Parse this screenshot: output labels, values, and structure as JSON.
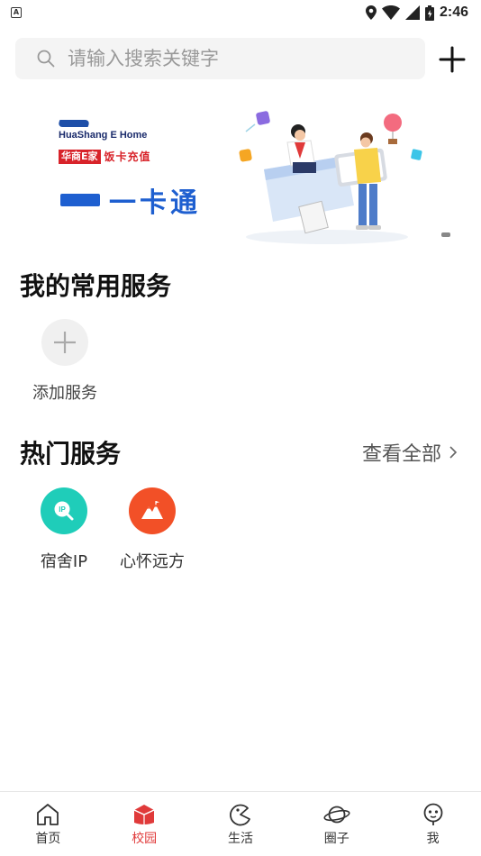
{
  "status_bar": {
    "time": "2:46",
    "notification_glyph": "A"
  },
  "search": {
    "placeholder": "请输入搜索关键字"
  },
  "banner": {
    "brand_en": "HuaShang E Home",
    "brand_tag": "华商E家",
    "tag_text": "饭卡充值",
    "title": "一卡通"
  },
  "favorites": {
    "title": "我的常用服务",
    "add_label": "添加服务"
  },
  "hot": {
    "title": "热门服务",
    "view_all": "查看全部",
    "items": [
      {
        "label": "宿舍IP",
        "color": "#1fcdb9",
        "icon": "ip-search-icon",
        "icon_text": "IP"
      },
      {
        "label": "心怀远方",
        "color": "#f25027",
        "icon": "mountain-icon"
      }
    ]
  },
  "tabbar": {
    "active_color": "#e03a3a",
    "items": [
      {
        "label": "首页",
        "icon": "home-icon"
      },
      {
        "label": "校园",
        "icon": "campus-icon",
        "active": true
      },
      {
        "label": "生活",
        "icon": "life-icon"
      },
      {
        "label": "圈子",
        "icon": "planet-icon"
      },
      {
        "label": "我",
        "icon": "profile-icon"
      }
    ]
  }
}
